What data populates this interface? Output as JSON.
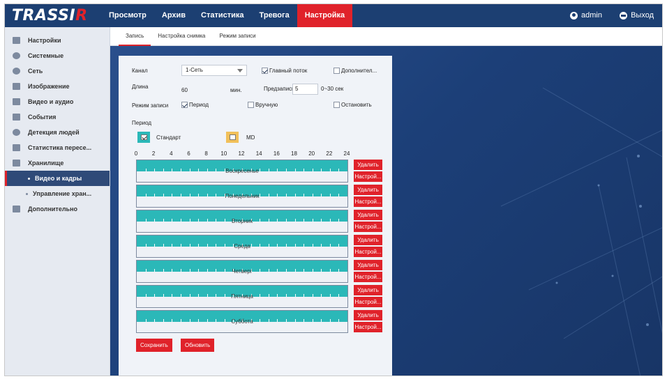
{
  "logo": {
    "text_main": "TRASSI",
    "text_accent": "R"
  },
  "nav": {
    "items": [
      {
        "label": "Просмотр"
      },
      {
        "label": "Архив"
      },
      {
        "label": "Статистика"
      },
      {
        "label": "Тревога"
      },
      {
        "label": "Настройка",
        "active": true
      }
    ],
    "user_label": "admin",
    "logout_label": "Выход"
  },
  "sidebar": {
    "items": [
      {
        "label": "Настройки",
        "icon": "monitor-icon"
      },
      {
        "label": "Системные",
        "icon": "info-icon"
      },
      {
        "label": "Сеть",
        "icon": "globe-icon"
      },
      {
        "label": "Изображение",
        "icon": "image-icon"
      },
      {
        "label": "Видео и аудио",
        "icon": "video-icon"
      },
      {
        "label": "События",
        "icon": "bell-icon"
      },
      {
        "label": "Детекция людей",
        "icon": "person-detect-icon"
      },
      {
        "label": "Статистика пересе...",
        "icon": "chart-icon"
      },
      {
        "label": "Хранилище",
        "icon": "storage-icon"
      },
      {
        "label": "Видео и кадры",
        "sub": true,
        "active": true
      },
      {
        "label": "Управление хран...",
        "sub": true
      },
      {
        "label": "Дополнительно",
        "icon": "tools-icon"
      }
    ]
  },
  "subtabs": [
    {
      "label": "Запись",
      "active": true
    },
    {
      "label": "Настройка снимка"
    },
    {
      "label": "Режим записи"
    }
  ],
  "form": {
    "channel_label": "Канал",
    "channel_value": "1-Сеть",
    "main_stream_label": "Главный поток",
    "main_stream_checked": true,
    "extra_label": "Дополнител...",
    "extra_checked": false,
    "length_label": "Длина",
    "length_value": "60",
    "length_unit": "мин.",
    "prerecord_label": "Предзапись",
    "prerecord_value": "5",
    "prerecord_range": "0~30 сек",
    "mode_label": "Режим записи",
    "mode_period_label": "Период",
    "mode_period_checked": true,
    "mode_manual_label": "Вручную",
    "mode_manual_checked": false,
    "mode_stop_label": "Остановить",
    "mode_stop_checked": false,
    "period_label": "Период",
    "legend_standard": "Стандарт",
    "legend_md": "MD",
    "legend_standard_color": "#2bb8b8",
    "legend_md_color": "#f1c05a"
  },
  "schedule": {
    "ticks": [
      "0",
      "2",
      "4",
      "6",
      "8",
      "10",
      "12",
      "14",
      "16",
      "18",
      "20",
      "22",
      "24"
    ],
    "days": [
      {
        "name": "Воскресенье"
      },
      {
        "name": "Понедельник"
      },
      {
        "name": "Вторник"
      },
      {
        "name": "Среда"
      },
      {
        "name": "Четверг"
      },
      {
        "name": "Пятница"
      },
      {
        "name": "Суббота"
      }
    ],
    "delete_label": "Удалить",
    "config_label": "Настрой..."
  },
  "buttons": {
    "save_label": "Сохранить",
    "refresh_label": "Обновить"
  },
  "colors": {
    "accent": "#e0222a",
    "navy": "#1c3f72",
    "schedule_fill": "#2bb8b8"
  }
}
